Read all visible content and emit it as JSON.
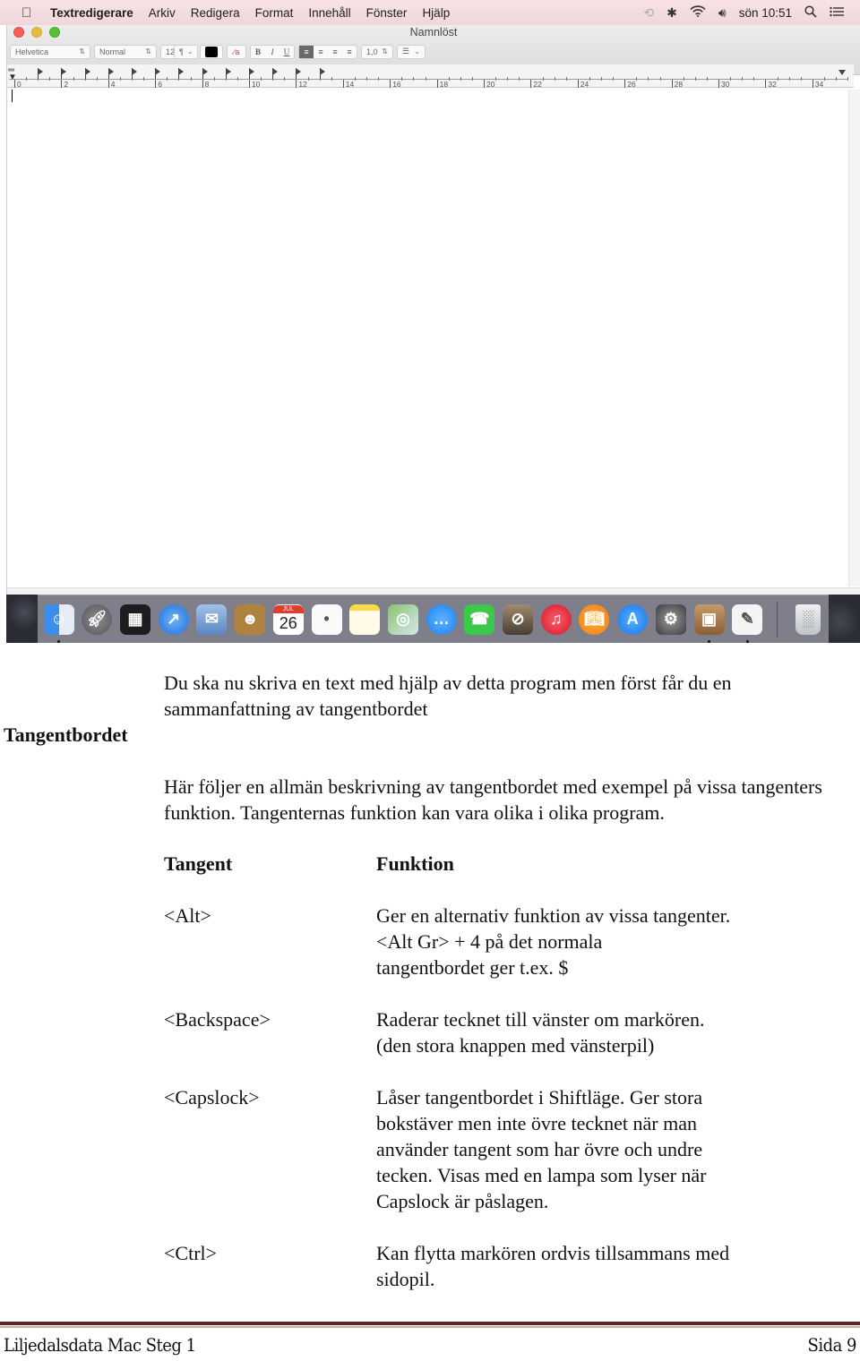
{
  "menubar": {
    "apple_icon": "apple-logo",
    "items": [
      "Textredigerare",
      "Arkiv",
      "Redigera",
      "Format",
      "Innehåll",
      "Fönster",
      "Hjälp"
    ],
    "status_icons": [
      "time-machine-icon",
      "bluetooth-icon",
      "wifi-icon",
      "volume-icon"
    ],
    "clock": "sön 10:51",
    "spotlight_icon": "search-icon",
    "notification_icon": "list-icon"
  },
  "window": {
    "title": "Namnlöst",
    "toolbar": {
      "paragraph_style": "¶",
      "font_family": "Helvetica",
      "font_style": "Normal",
      "font_size": "12",
      "text_color": "#000000",
      "bold": "B",
      "italic": "I",
      "underline": "U",
      "alignments": [
        "left",
        "center",
        "right",
        "justify"
      ],
      "active_alignment": "left",
      "line_spacing": "1,0",
      "list_icon": "list-bullets-icon"
    },
    "ruler": {
      "labels": [
        "0",
        "2",
        "4",
        "6",
        "8",
        "10",
        "12",
        "14",
        "16",
        "18",
        "20",
        "22",
        "24",
        "26",
        "28",
        "30",
        "32",
        "34"
      ]
    }
  },
  "dock": {
    "apps": [
      {
        "name": "Finder",
        "running": true
      },
      {
        "name": "Launchpad",
        "running": false
      },
      {
        "name": "Mission Control",
        "running": false
      },
      {
        "name": "Safari",
        "running": false
      },
      {
        "name": "Mail",
        "running": false
      },
      {
        "name": "Kontakter",
        "running": false
      },
      {
        "name": "Kalender",
        "running": false,
        "month": "JUL",
        "day": "26"
      },
      {
        "name": "Påminnelser",
        "running": false
      },
      {
        "name": "Anteckningar",
        "running": false
      },
      {
        "name": "Kartor",
        "running": false
      },
      {
        "name": "Meddelanden",
        "running": false
      },
      {
        "name": "FaceTime",
        "running": false
      },
      {
        "name": "Photo Booth",
        "running": false
      },
      {
        "name": "iTunes",
        "running": false
      },
      {
        "name": "iBooks",
        "running": false
      },
      {
        "name": "App Store",
        "running": false
      },
      {
        "name": "Systeminställningar",
        "running": false
      },
      {
        "name": "Installationsprogram",
        "running": true
      },
      {
        "name": "Textredigerare",
        "running": true
      }
    ],
    "trash": "Papperskorg"
  },
  "document": {
    "side_heading": "Tangentbordet",
    "intro": "Du ska nu skriva en text med hjälp av detta program men först får du en sammanfattning av tangentbordet",
    "description": "Här följer en allmän beskrivning av tangentbordet med exempel på vissa tangenters funktion. Tangenternas funktion kan vara olika i olika program.",
    "table": {
      "headers": {
        "key": "Tangent",
        "function": "Funktion"
      },
      "rows": [
        {
          "key": "<Alt>",
          "function_lines": [
            "Ger en alternativ funktion av vissa tangenter.",
            "<Alt Gr> + 4 på det normala",
            "tangentbordet ger t.ex. $"
          ]
        },
        {
          "key": "<Backspace>",
          "function_lines": [
            "Raderar tecknet till vänster om markören.",
            "(den stora knappen med vänsterpil)"
          ]
        },
        {
          "key": "<Capslock>",
          "function_lines": [
            "Låser tangentbordet i Shiftläge. Ger stora",
            "bokstäver men inte övre tecknet när man",
            "använder tangent som har övre och undre",
            "tecken. Visas med en lampa som lyser när",
            "Capslock är påslagen."
          ]
        },
        {
          "key": "<Ctrl>",
          "function_lines": [
            "Kan flytta markören ordvis tillsammans med",
            "sidopil."
          ]
        }
      ]
    },
    "footer": {
      "left": "Liljedalsdata Mac Steg 1",
      "right": "Sida 9"
    }
  }
}
